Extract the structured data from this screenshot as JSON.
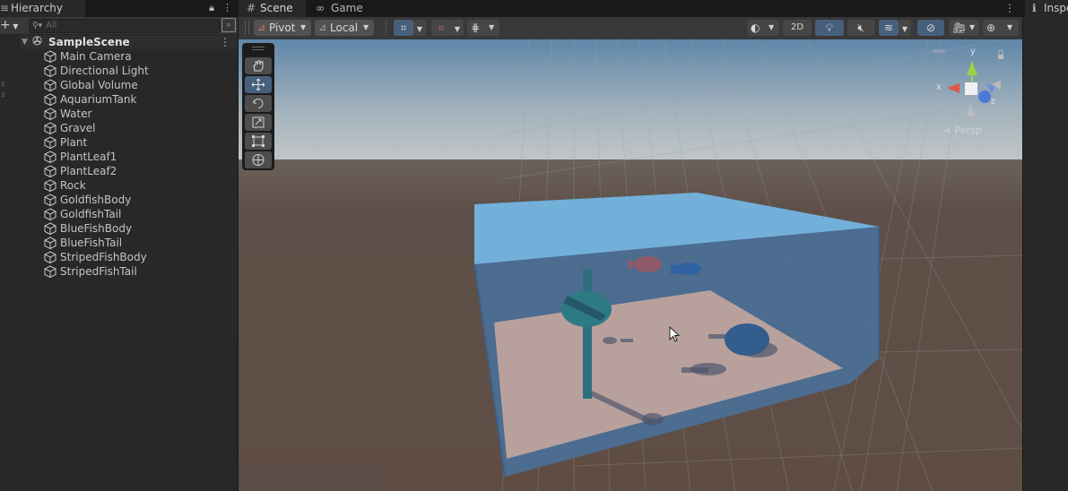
{
  "hierarchy": {
    "tab_label": "Hierarchy",
    "search_placeholder": "All",
    "scene_name": "SampleScene",
    "items": [
      {
        "label": "Main Camera"
      },
      {
        "label": "Directional Light"
      },
      {
        "label": "Global Volume"
      },
      {
        "label": "AquariumTank"
      },
      {
        "label": "Water"
      },
      {
        "label": "Gravel"
      },
      {
        "label": "Plant"
      },
      {
        "label": "PlantLeaf1"
      },
      {
        "label": "PlantLeaf2"
      },
      {
        "label": "Rock"
      },
      {
        "label": "GoldfishBody"
      },
      {
        "label": "GoldfishTail"
      },
      {
        "label": "BlueFishBody"
      },
      {
        "label": "BlueFishTail"
      },
      {
        "label": "StripedFishBody"
      },
      {
        "label": "StripedFishTail"
      }
    ]
  },
  "tabs": {
    "scene": "Scene",
    "game": "Game"
  },
  "scene_toolbar": {
    "pivot": "Pivot",
    "local": "Local",
    "mode_2d": "2D"
  },
  "gizmo": {
    "projection": "Persp",
    "axis_y": "y",
    "axis_x": "x",
    "axis_z": "z"
  },
  "inspector": {
    "tab_label": "Inspe"
  },
  "colors": {
    "panel": "#282828",
    "toolbar": "#383838",
    "accent_blue": "#46607c",
    "sky": "#a9b5c0",
    "ground": "#5e5048",
    "water_top": "#71aed8",
    "tank_glass": "#4f7398",
    "gravel_floor": "#b9a19c"
  }
}
